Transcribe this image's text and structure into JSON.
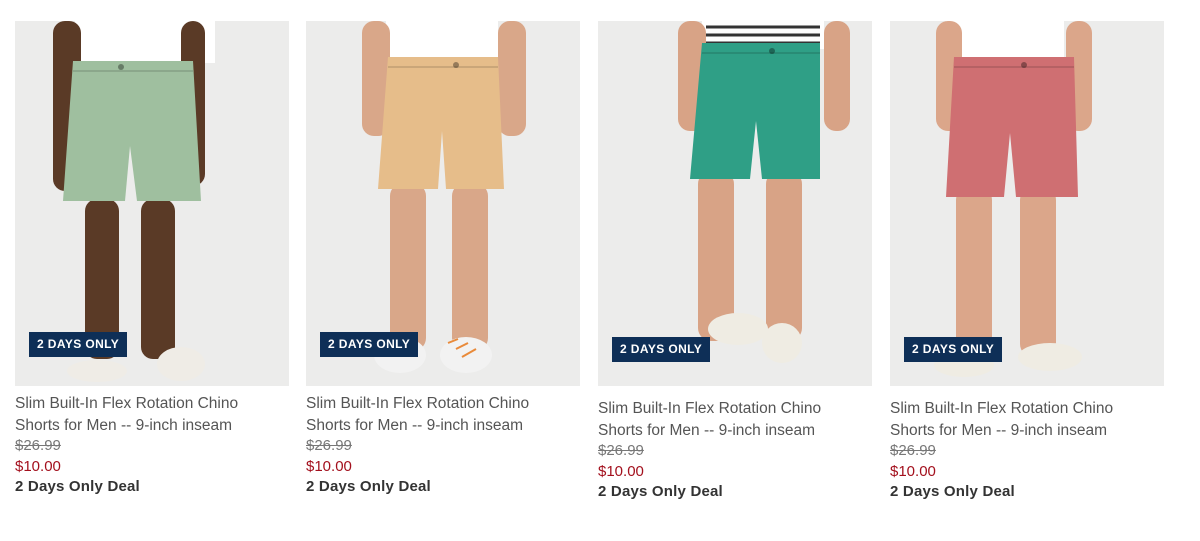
{
  "products": [
    {
      "badge": "2 DAYS ONLY",
      "title": "Slim Built-In Flex Rotation Chino Shorts for Men -- 9-inch inseam",
      "original_price": "$26.99",
      "sale_price": "$10.00",
      "deal_label": "2 Days Only Deal",
      "short_color": "#9fbf9f",
      "skin_color": "#5a3a26",
      "shoe_color": "#efece6"
    },
    {
      "badge": "2 DAYS ONLY",
      "title": "Slim Built-In Flex Rotation Chino Shorts for Men -- 9-inch inseam",
      "original_price": "$26.99",
      "sale_price": "$10.00",
      "deal_label": "2 Days Only Deal",
      "short_color": "#e6bd8a",
      "skin_color": "#d9a789",
      "shoe_color": "#f2f2f2"
    },
    {
      "badge": "2 DAYS ONLY",
      "title": "Slim Built-In Flex Rotation Chino Shorts for Men -- 9-inch inseam",
      "original_price": "$26.99",
      "sale_price": "$10.00",
      "deal_label": "2 Days Only Deal",
      "short_color": "#2f9f86",
      "skin_color": "#d8a386",
      "shoe_color": "#efece3"
    },
    {
      "badge": "2 DAYS ONLY",
      "title": "Slim Built-In Flex Rotation Chino Shorts for Men -- 9-inch inseam",
      "original_price": "$26.99",
      "sale_price": "$10.00",
      "deal_label": "2 Days Only Deal",
      "short_color": "#cf6f72",
      "skin_color": "#dba68a",
      "shoe_color": "#efece3"
    }
  ]
}
